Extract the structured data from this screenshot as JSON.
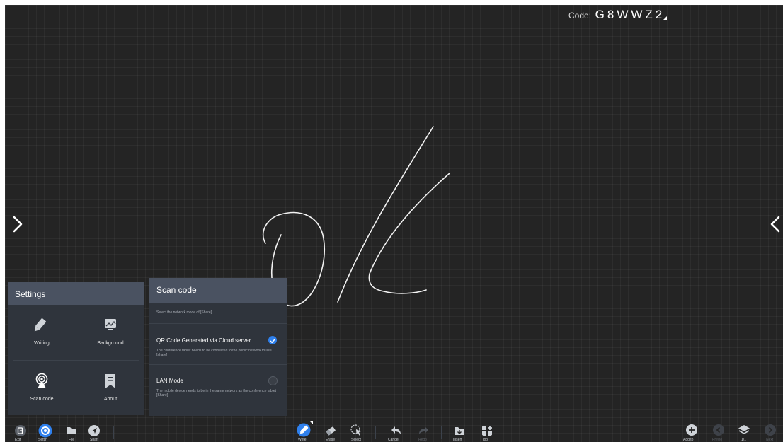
{
  "header": {
    "code_label": "Code:",
    "code_value": "G8WWZ2"
  },
  "settings": {
    "title": "Settings",
    "items": [
      {
        "label": "Writing",
        "icon": "pen-icon"
      },
      {
        "label": "Background",
        "icon": "background-icon"
      },
      {
        "label": "Scan code",
        "icon": "scan-code-icon"
      },
      {
        "label": "About",
        "icon": "about-icon"
      }
    ]
  },
  "scan_code": {
    "title": "Scan code",
    "description": "Select the network mode of [Share]",
    "options": [
      {
        "title": "QR Code Generated via Cloud server",
        "description": "The conference tablet needs to be connected to the public network to use [share]",
        "selected": true
      },
      {
        "title": "LAN Mode",
        "description": "The mobile device needs to be in the same network as the conference tablet [Share]",
        "selected": false
      }
    ]
  },
  "toolbar": {
    "left": [
      {
        "label": "Exit",
        "icon": "exit-icon"
      },
      {
        "label": "Settin",
        "icon": "settings-icon"
      },
      {
        "label": "File",
        "icon": "folder-icon"
      },
      {
        "label": "Shari",
        "icon": "share-icon"
      }
    ],
    "center": [
      {
        "label": "Write",
        "icon": "pen-icon"
      },
      {
        "label": "Erase",
        "icon": "eraser-icon"
      },
      {
        "label": "Select",
        "icon": "select-icon"
      },
      {
        "label": "Cancel",
        "icon": "undo-icon"
      },
      {
        "label": "Redo",
        "icon": "redo-icon"
      },
      {
        "label": "Insert",
        "icon": "insert-icon"
      },
      {
        "label": "Tool",
        "icon": "tool-icon"
      }
    ],
    "right": [
      {
        "label": "Add to",
        "icon": "add-icon"
      },
      {
        "label": "Previo",
        "icon": "previous-icon"
      },
      {
        "label": "1/1",
        "icon": "layers-icon"
      },
      {
        "label": "Next",
        "icon": "next-icon"
      }
    ]
  },
  "colors": {
    "board_bg": "#242424",
    "panel_bg": "#2f343c",
    "panel_header": "#4a5261",
    "accent": "#2f80ed"
  }
}
